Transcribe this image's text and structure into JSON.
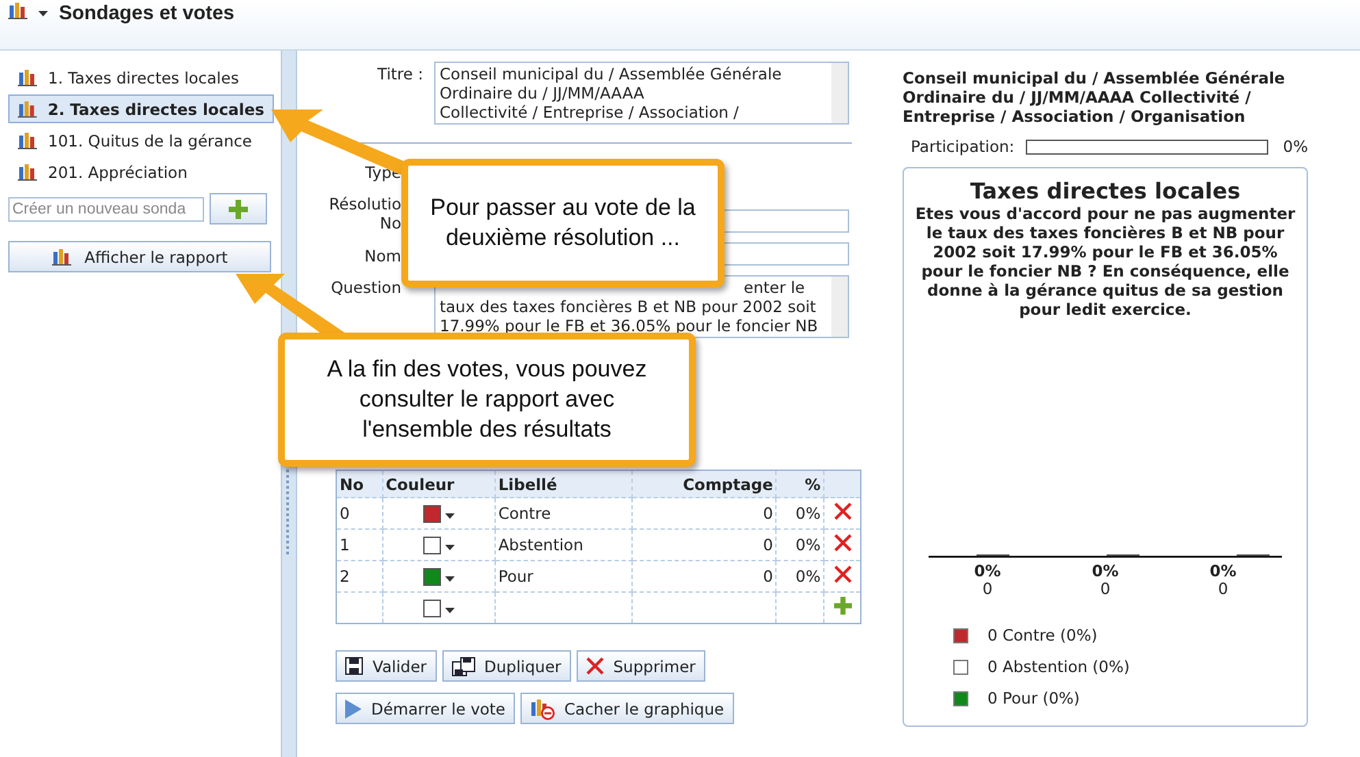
{
  "header": {
    "title": "Sondages et votes"
  },
  "sidebar": {
    "items": [
      {
        "label": "1. Taxes directes locales",
        "selected": false
      },
      {
        "label": "2. Taxes directes locales",
        "selected": true
      },
      {
        "label": "101. Quitus de la gérance",
        "selected": false
      },
      {
        "label": "201. Appréciation",
        "selected": false
      }
    ],
    "new_poll": {
      "placeholder": "Créer un nouveau sonda"
    },
    "report_button": "Afficher le rapport"
  },
  "form": {
    "title_label": "Titre :",
    "title_lines": [
      "Conseil municipal du / Assemblée Générale",
      "Ordinaire du / JJ/MM/AAAA",
      "Collectivité  / Entreprise / Association /"
    ],
    "fields": [
      {
        "kind": "hidden",
        "label": "Type"
      },
      {
        "kind": "input",
        "label": "Résolutio",
        "sublabel": "No"
      },
      {
        "kind": "input",
        "label": "Nom"
      },
      {
        "kind": "textarea",
        "label": "Question",
        "lines": [
          "enter le",
          "taux des taxes foncières B et NB pour 2002 soit",
          "17.99% pour le FB et 36.05% pour le foncier NB"
        ]
      }
    ]
  },
  "table": {
    "columns": [
      "No",
      "Couleur",
      "Libellé",
      "Comptage",
      "%"
    ],
    "rows": [
      {
        "kind": "option",
        "no": "0",
        "color": "#c0282d",
        "label": "Contre",
        "count": "0",
        "percent": "0%"
      },
      {
        "kind": "option",
        "no": "1",
        "color": "#ffffff",
        "label": "Abstention",
        "count": "0",
        "percent": "0%"
      },
      {
        "kind": "option",
        "no": "2",
        "color": "#10891a",
        "label": "Pour",
        "count": "0",
        "percent": "0%"
      },
      {
        "kind": "new",
        "color": "#ffffff"
      }
    ]
  },
  "buttons": [
    {
      "kind": "save",
      "label": "Valider"
    },
    {
      "kind": "duplicate",
      "label": "Dupliquer"
    },
    {
      "kind": "delete",
      "label": "Supprimer"
    },
    {
      "kind": "start",
      "label": "Démarrer le vote"
    },
    {
      "kind": "hide_chart",
      "label": "Cacher le graphique"
    }
  ],
  "preview": {
    "heading": "Conseil municipal du / Assemblée Générale Ordinaire du / JJ/MM/AAAA Collectivité / Entreprise / Association / Organisation",
    "participation": {
      "label": "Participation:",
      "level": 0,
      "reading": "0%"
    },
    "card": {
      "title": "Taxes directes locales",
      "question": "Etes vous d'accord pour ne pas augmenter le taux des taxes foncières B et NB pour 2002 soit 17.99% pour le FB et 36.05% pour le foncier NB ? En conséquence, elle donne à la gérance quitus de sa gestion pour ledit exercice.",
      "bar_labels": [
        {
          "percent": "0%",
          "count": "0"
        },
        {
          "percent": "0%",
          "count": "0"
        },
        {
          "percent": "0%",
          "count": "0"
        }
      ],
      "legend": [
        {
          "label": "0 Contre (0%)",
          "color": "#c0282d"
        },
        {
          "label": "0 Abstention (0%)",
          "color": "#ffffff"
        },
        {
          "label": "0 Pour (0%)",
          "color": "#10891a"
        }
      ]
    }
  },
  "callouts": [
    {
      "text": "Pour passer au vote de la deuxième résolution ..."
    },
    {
      "text": "A la fin des votes, vous pouvez consulter le rapport avec l'ensemble des résultats"
    }
  ]
}
